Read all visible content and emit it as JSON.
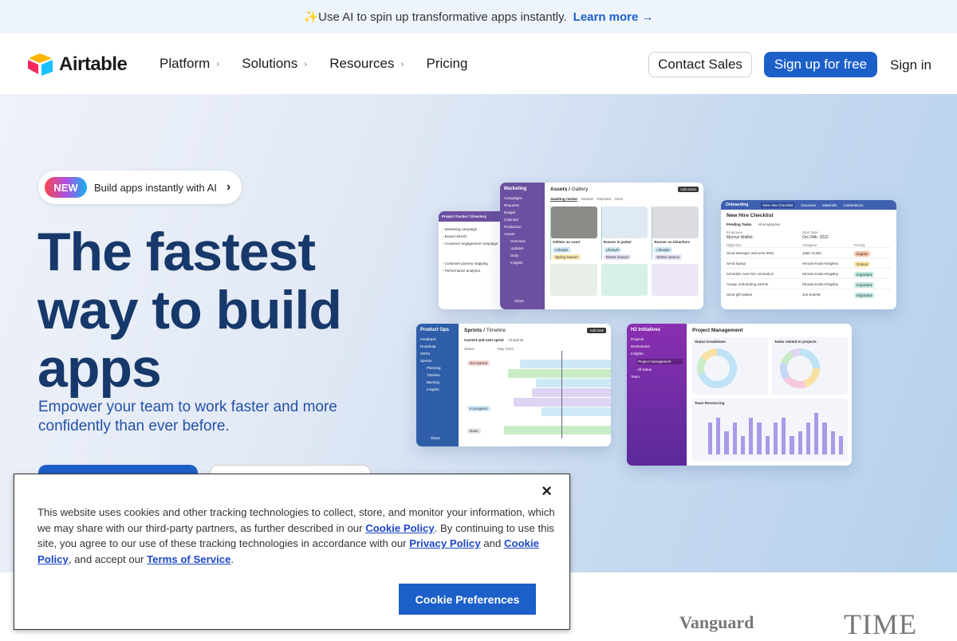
{
  "announcement": {
    "sparkle_icon": "sparkle-icon",
    "text": "Use AI to spin up transformative apps instantly.",
    "link": "Learn more",
    "arrow": "→"
  },
  "nav": {
    "brand": "Airtable",
    "items": [
      {
        "label": "Platform",
        "chevron": "›"
      },
      {
        "label": "Solutions",
        "chevron": "›"
      },
      {
        "label": "Resources",
        "chevron": "›"
      },
      {
        "label": "Pricing"
      }
    ],
    "contact_sales": "Contact Sales",
    "sign_up": "Sign up for free",
    "sign_in": "Sign in"
  },
  "hero": {
    "badge": "NEW",
    "badge_text": "Build apps instantly with AI",
    "badge_arrow": "›",
    "headline": "The fastest way to build apps",
    "subheadline": "Empower your team to work faster and more confidently than ever before."
  },
  "mockups": {
    "tracker": {
      "title": "Project Tracker / Directory",
      "items": [
        "Marketing campaign",
        "Brand refresh",
        "Customer engagement campaign",
        "Customer journey mapping",
        "Performance analytics"
      ]
    },
    "marketing": {
      "workspace": "Marketing",
      "nav": [
        "Campaigns",
        "Requests",
        "Budget",
        "Calendar",
        "Production",
        "Assets"
      ],
      "sub_nav": [
        "Overview",
        "Updates",
        "Daily",
        "Insights"
      ],
      "share": "Share",
      "title": "Assets",
      "view": "Gallery",
      "add": "Add asset",
      "tabs": [
        "Awaiting review",
        "Started",
        "Rejected",
        "More"
      ],
      "assets": [
        {
          "name": "Athlete on court",
          "tags": [
            "Lifestyle",
            "Spring season"
          ]
        },
        {
          "name": "Runner in jacket",
          "tags": [
            "Lifestyle",
            "Winter season"
          ]
        },
        {
          "name": "Runner on bleachers",
          "tags": [
            "Lifestyle",
            "Winter season"
          ]
        }
      ]
    },
    "onboarding": {
      "workspace": "Onboarding",
      "tabs": [
        "New Hire Checklist",
        "Overview",
        "Materials",
        "Celebrations"
      ],
      "title": "New Hire Checklist",
      "subtabs": [
        "Pending Tasks",
        "All employees"
      ],
      "employee_label": "Employee",
      "employee": "Myrnyn Walliet",
      "start_label": "Start date",
      "start": "Oct 24th, 2022",
      "cols": [
        "Objective",
        "Assignee",
        "Priority"
      ],
      "rows": [
        {
          "task": "Send Manager welcome letter",
          "who": "Jalen Curtis",
          "priority": "Urgent",
          "color": "#f7c3a8"
        },
        {
          "task": "Send laptop",
          "who": "Hiroara Kodo-Kingsley",
          "priority": "Critical",
          "color": "#f8e7a3"
        },
        {
          "task": "Schedule new hire orientation",
          "who": "Hiroara Kodo-Kingsley",
          "priority": "Important",
          "color": "#bfe9e2"
        },
        {
          "task": "Assign onboarding partner",
          "who": "Hiroara Kodo-Kingsley",
          "priority": "Important",
          "color": "#bfe9e2"
        },
        {
          "task": "Send gift basket",
          "who": "Jon Everett",
          "priority": "Important",
          "color": "#bfe9e2"
        }
      ]
    },
    "sprints": {
      "workspace": "Product Ops",
      "nav": [
        "Feedback",
        "Roadmap",
        "OKRs",
        "Sprints"
      ],
      "sub_nav": [
        "Planning",
        "Timeline",
        "Backlog",
        "Insights"
      ],
      "share": "Share",
      "title": "Sprints",
      "view": "Timeline",
      "add": "Add task",
      "tabs": [
        "Current and next sprint",
        "All sprints"
      ],
      "status_col": "Status",
      "month": "May 2023",
      "groups": [
        "Not started",
        "In progress",
        "Done"
      ]
    },
    "initiatives": {
      "workspace": "H2 Initiatives",
      "nav": [
        "Projects",
        "Workstream",
        "Insights",
        "Team"
      ],
      "sub_nav": [
        "Project management",
        "All status"
      ],
      "title": "Project Management",
      "panels": [
        "Status breakdown",
        "Tasks related to projects",
        "Team Resourcing"
      ],
      "bars": [
        7,
        8,
        5,
        7,
        4,
        8,
        7,
        4,
        7,
        8,
        4,
        5,
        7,
        9,
        7,
        5,
        4
      ]
    }
  },
  "logos": [
    "Vanguard",
    "TIME"
  ],
  "cookie": {
    "close": "×",
    "text1": "This website uses cookies and other tracking technologies to collect, store, and monitor your information, which we may share with our third-party partners, as further described in our ",
    "link1": "Cookie Policy",
    "text2": ". By continuing to use this site, you agree to our use of these tracking technologies in accordance with our ",
    "link2": "Privacy Policy",
    "text3": " and ",
    "link3": "Cookie Policy",
    "text4": ", and accept our ",
    "link4": "Terms of Service",
    "text5": ".",
    "button": "Cookie Preferences"
  },
  "colors": {
    "primary": "#1d5fc9",
    "headline": "#17386a",
    "subheadline": "#2451a6"
  }
}
